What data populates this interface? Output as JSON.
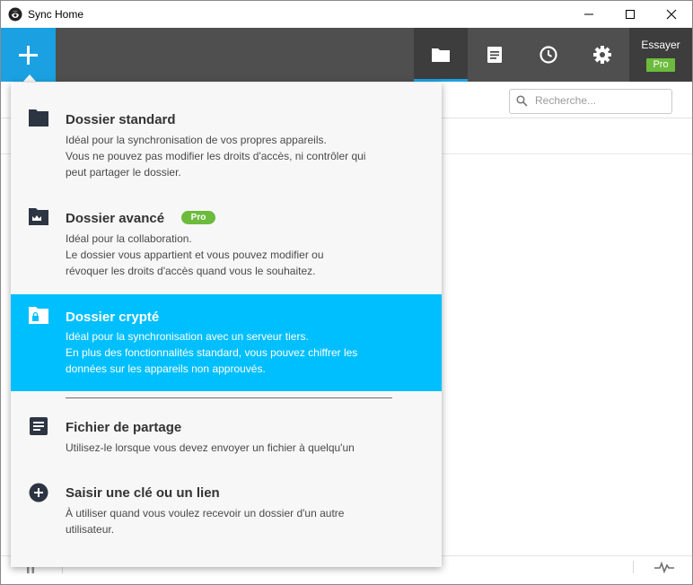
{
  "window": {
    "title": "Sync Home"
  },
  "toolbar": {
    "add_icon": "plus-icon",
    "tabs": [
      {
        "icon": "folder-icon",
        "active": true
      },
      {
        "icon": "notes-icon",
        "active": false
      },
      {
        "icon": "clock-icon",
        "active": false
      },
      {
        "icon": "gear-icon",
        "active": false
      }
    ],
    "try_label": "Essayer",
    "pro_badge": "Pro",
    "accent_color": "#1ba1e2",
    "pro_color": "#6cbb3c"
  },
  "search": {
    "placeholder": "Recherche..."
  },
  "menu": {
    "items": [
      {
        "title": "Dossier standard",
        "desc": [
          "Idéal pour la synchronisation de vos propres appareils.",
          "Vous ne pouvez pas modifier les droits d'accès, ni contrôler qui",
          "peut partager le dossier."
        ],
        "icon": "folder-icon"
      },
      {
        "title": "Dossier avancé",
        "badge": "Pro",
        "desc": [
          "Idéal pour la collaboration.",
          "Le dossier vous appartient et vous pouvez modifier ou",
          "révoquer les droits d'accès quand vous le souhaitez."
        ],
        "icon": "crown-folder-icon"
      },
      {
        "title": "Dossier crypté",
        "desc": [
          "Idéal pour la synchronisation avec un serveur tiers.",
          "En plus des fonctionnalités standard, vous pouvez chiffrer les",
          "données sur les appareils non approuvés."
        ],
        "icon": "lock-folder-icon",
        "selected": true,
        "highlight_color": "#00bfff"
      },
      {
        "title": "Fichier de partage",
        "desc": [
          "Utilisez-le lorsque vous devez envoyer un fichier à quelqu'un"
        ],
        "icon": "file-icon"
      },
      {
        "title": "Saisir une clé ou un lien",
        "desc": [
          "À utiliser quand vous voulez recevoir un dossier d'un autre",
          "utilisateur."
        ],
        "icon": "plus-circle-icon"
      }
    ]
  },
  "statusbar": {
    "left_icon": "pause-icon",
    "right_icon": "activity-icon"
  }
}
